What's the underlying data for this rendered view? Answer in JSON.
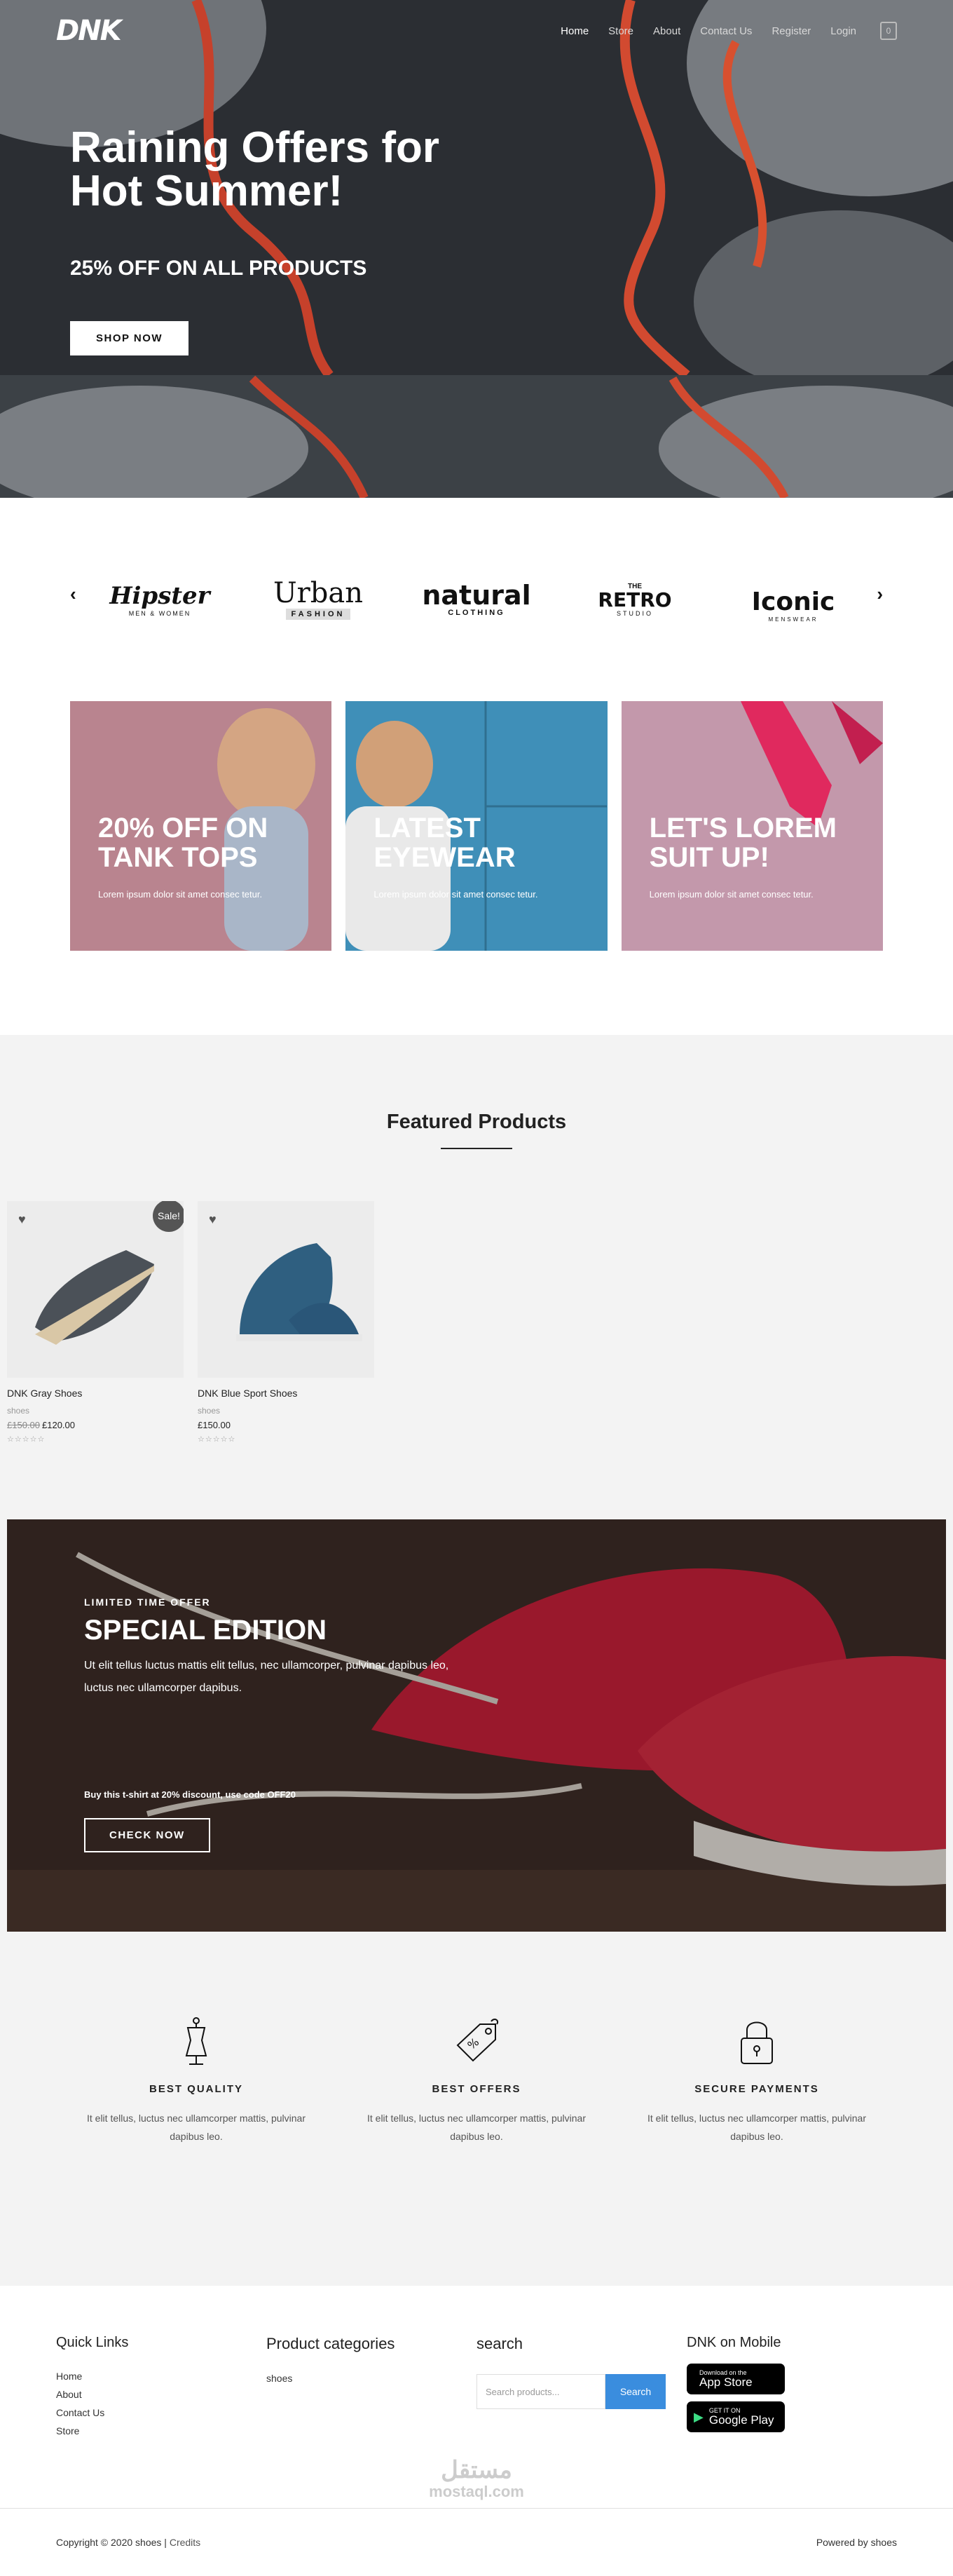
{
  "nav": {
    "logo": "DNK",
    "links": [
      "Home",
      "Store",
      "About",
      "Contact Us",
      "Register",
      "Login"
    ],
    "active": "Home",
    "cart_count": "0"
  },
  "hero": {
    "title": "Raining Offers for Hot Summer!",
    "subtitle": "25% OFF ON ALL PRODUCTS",
    "button": "SHOP NOW"
  },
  "brands": {
    "prev": "‹",
    "next": "›",
    "items": [
      {
        "name": "Hipster",
        "tagline": "MEN & WOMEN"
      },
      {
        "name": "Urban",
        "tagline": "FASHION"
      },
      {
        "name": "natural",
        "tagline": "CLOTHING"
      },
      {
        "name": "RETRO",
        "tagline": "STUDIO",
        "prefix": "THE"
      },
      {
        "name": "Iconic",
        "tagline": "MENSWEAR"
      }
    ]
  },
  "promos": [
    {
      "title": "20% OFF ON TANK TOPS",
      "desc": "Lorem ipsum dolor sit amet consec tetur.",
      "color": "#b9848f"
    },
    {
      "title": "LATEST EYEWEAR",
      "desc": "Lorem ipsum dolor sit amet consec tetur.",
      "color": "#3f8fb8"
    },
    {
      "title": "LET'S LOREM SUIT UP!",
      "desc": "Lorem ipsum dolor sit amet consec tetur.",
      "color": "#c398ab"
    }
  ],
  "featured": {
    "title": "Featured Products",
    "products": [
      {
        "name": "DNK Gray Shoes",
        "category": "shoes",
        "old_price": "£150.00",
        "price": "£120.00",
        "sale": "Sale!",
        "rating": 0
      },
      {
        "name": "DNK Blue Sport Shoes",
        "category": "shoes",
        "old_price": "",
        "price": "£150.00",
        "sale": "",
        "rating": 0
      }
    ]
  },
  "special": {
    "kicker": "LIMITED TIME OFFER",
    "title": "SPECIAL EDITION",
    "text": "Ut elit tellus luctus mattis elit tellus, nec ullamcorper, pulvinar dapibus leo, luctus nec ullamcorper dapibus.",
    "code": "Buy this t-shirt at 20% discount, use code OFF20",
    "button": "CHECK NOW"
  },
  "features": [
    {
      "icon": "dress-icon",
      "title": "BEST QUALITY",
      "desc": "It elit tellus, luctus nec ullamcorper mattis, pulvinar dapibus leo."
    },
    {
      "icon": "price-tag-icon",
      "title": "BEST OFFERS",
      "desc": "It elit tellus, luctus nec ullamcorper mattis, pulvinar dapibus leo."
    },
    {
      "icon": "lock-icon",
      "title": "SECURE PAYMENTS",
      "desc": "It elit tellus, luctus nec ullamcorper mattis, pulvinar dapibus leo."
    }
  ],
  "footer": {
    "quick_links": {
      "title": "Quick Links",
      "items": [
        "Home",
        "About",
        "Contact Us",
        "Store"
      ]
    },
    "categories": {
      "title": "Product categories",
      "items": [
        "shoes"
      ]
    },
    "search": {
      "title": "search",
      "placeholder": "Search products...",
      "button": "Search"
    },
    "mobile": {
      "title": "DNK on Mobile",
      "app_store": {
        "small": "Download on the",
        "large": "App Store"
      },
      "google_play": {
        "small": "GET IT ON",
        "large": "Google Play"
      }
    },
    "watermark": {
      "main": "مستقل",
      "sub": "mostaql.com"
    },
    "copyright": "Copyright © 2020 shoes |",
    "credits": "Credits",
    "powered": "Powered by shoes"
  }
}
